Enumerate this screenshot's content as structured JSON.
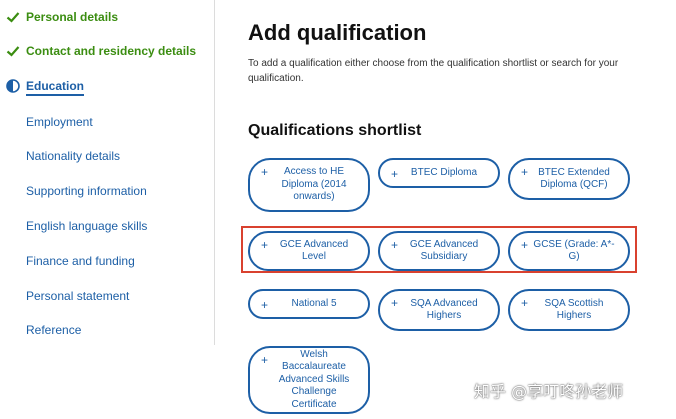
{
  "nav": {
    "items": [
      {
        "label": "Personal details",
        "state": "done"
      },
      {
        "label": "Contact and residency details",
        "state": "done"
      },
      {
        "label": "Education",
        "state": "current"
      },
      {
        "label": "Employment",
        "state": "todo"
      },
      {
        "label": "Nationality details",
        "state": "todo"
      },
      {
        "label": "Supporting information",
        "state": "todo"
      },
      {
        "label": "English language skills",
        "state": "todo"
      },
      {
        "label": "Finance and funding",
        "state": "todo"
      },
      {
        "label": "Personal statement",
        "state": "todo"
      },
      {
        "label": "Reference",
        "state": "todo"
      }
    ]
  },
  "main": {
    "title": "Add qualification",
    "intro": "To add a qualification either choose from the qualification shortlist or search for your qualification.",
    "shortlist_title": "Qualifications shortlist",
    "plus_symbol": "+",
    "qualifications": [
      {
        "label": "Access to HE Diploma (2014 onwards)"
      },
      {
        "label": "BTEC Diploma"
      },
      {
        "label": "BTEC Extended Diploma (QCF)"
      },
      {
        "label": "GCE Advanced Level"
      },
      {
        "label": "GCE Advanced Subsidiary"
      },
      {
        "label": "GCSE (Grade: A*-G)"
      },
      {
        "label": "National 5"
      },
      {
        "label": "SQA Advanced Highers"
      },
      {
        "label": "SQA Scottish Highers"
      },
      {
        "label": "Welsh Baccalaureate Advanced Skills Challenge Certificate"
      }
    ]
  },
  "watermark": "知乎 @享叮咚孙老师",
  "colors": {
    "done": "#3b8d11",
    "link": "#1d5fa6",
    "highlight": "#d9412f"
  }
}
